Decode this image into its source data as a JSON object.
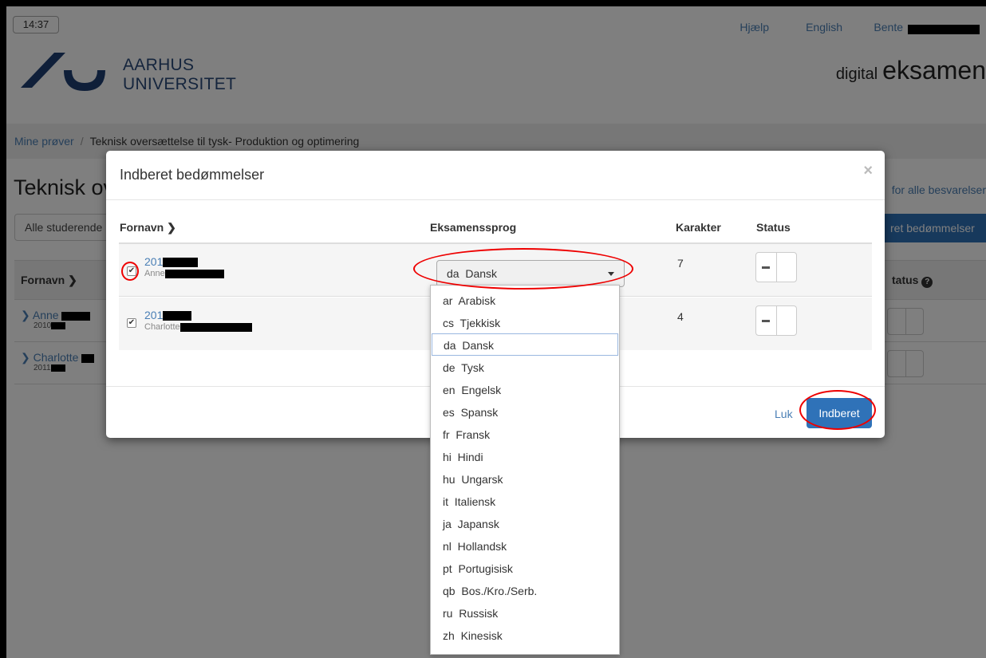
{
  "header": {
    "clock": "14:37",
    "help_link": "Hjælp",
    "language_link": "English",
    "user_name": "Bente",
    "university_line1": "AARHUS",
    "university_line2": "UNIVERSITET",
    "app_name_prefix": "digital",
    "app_name_main": "eksamen"
  },
  "breadcrumb": {
    "home": "Mine prøver",
    "separator": "/",
    "current": "Teknisk oversættelse til tysk- Produktion og optimering"
  },
  "background_page": {
    "title": "Teknisk ov",
    "filter_value": "Alle studerende",
    "right_link": "for alle besvarelser",
    "right_button": "ret bedømmelser",
    "column_fornavn": "Fornavn",
    "column_status": "tatus",
    "rows": [
      {
        "name": "Anne",
        "year": "2010"
      },
      {
        "name": "Charlotte",
        "year": "2011"
      }
    ]
  },
  "modal": {
    "title": "Indberet bedømmelser",
    "close": "×",
    "columns": {
      "fornavn": "Fornavn",
      "eksamenssprog": "Eksamenssprog",
      "karakter": "Karakter",
      "status": "Status"
    },
    "rows": [
      {
        "student_id": "201",
        "name": "Anne",
        "karakter": "7",
        "checked": true
      },
      {
        "student_id": "201",
        "name": "Charlotte",
        "karakter": "4",
        "checked": true
      }
    ],
    "selected_language": "da  Dansk",
    "close_link": "Luk",
    "submit_button": "Indberet"
  },
  "language_options": [
    "ar  Arabisk",
    "cs  Tjekkisk",
    "da  Dansk",
    "de  Tysk",
    "en  Engelsk",
    "es  Spansk",
    "fr  Fransk",
    "hi  Hindi",
    "hu  Ungarsk",
    "it  Italiensk",
    "ja  Japansk",
    "nl  Hollandsk",
    "pt  Portugisisk",
    "qb  Bos./Kro./Serb.",
    "ru  Russisk",
    "zh  Kinesisk"
  ],
  "colors": {
    "link": "#4a7fb5",
    "primary_button": "#2f72b8",
    "highlight": "#e00000"
  }
}
